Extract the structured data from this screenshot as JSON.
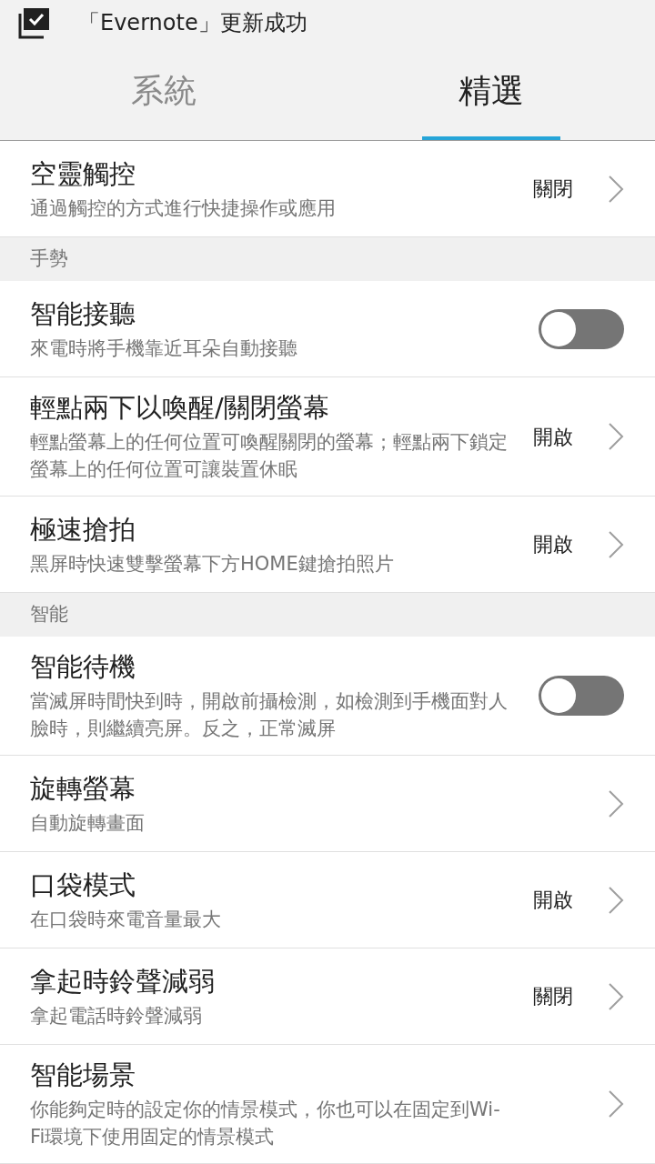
{
  "notification": {
    "text": "「Evernote」更新成功"
  },
  "tabs": [
    {
      "label": "系統",
      "selected": false
    },
    {
      "label": "精選",
      "selected": true
    }
  ],
  "items": [
    {
      "kind": "link",
      "title": "空靈觸控",
      "description": "通過觸控的方式進行快捷操作或應用",
      "value": "關閉"
    },
    {
      "kind": "section",
      "title": "手勢"
    },
    {
      "kind": "toggle",
      "title": "智能接聽",
      "description": "來電時將手機靠近耳朵自動接聽",
      "on": false
    },
    {
      "kind": "link",
      "title": "輕點兩下以喚醒/關閉螢幕",
      "description": "輕點螢幕上的任何位置可喚醒關閉的螢幕；輕點兩下鎖定螢幕上的任何位置可讓裝置休眠",
      "value": "開啟"
    },
    {
      "kind": "link",
      "title": "極速搶拍",
      "description": "黑屏時快速雙擊螢幕下方HOME鍵搶拍照片",
      "value": "開啟"
    },
    {
      "kind": "section",
      "title": "智能"
    },
    {
      "kind": "toggle",
      "title": "智能待機",
      "description": "當滅屏時間快到時，開啟前攝檢測，如檢測到手機面對人臉時，則繼續亮屏。反之，正常滅屏",
      "on": false
    },
    {
      "kind": "link",
      "title": "旋轉螢幕",
      "description": "自動旋轉畫面"
    },
    {
      "kind": "link",
      "title": "口袋模式",
      "description": "在口袋時來電音量最大",
      "value": "開啟"
    },
    {
      "kind": "link",
      "title": "拿起時鈴聲減弱",
      "description": "拿起電話時鈴聲減弱",
      "value": "關閉"
    },
    {
      "kind": "link",
      "title": "智能場景",
      "description": "你能夠定時的設定你的情景模式，你也可以在固定到Wi-Fi環境下使用固定的情景模式"
    }
  ]
}
